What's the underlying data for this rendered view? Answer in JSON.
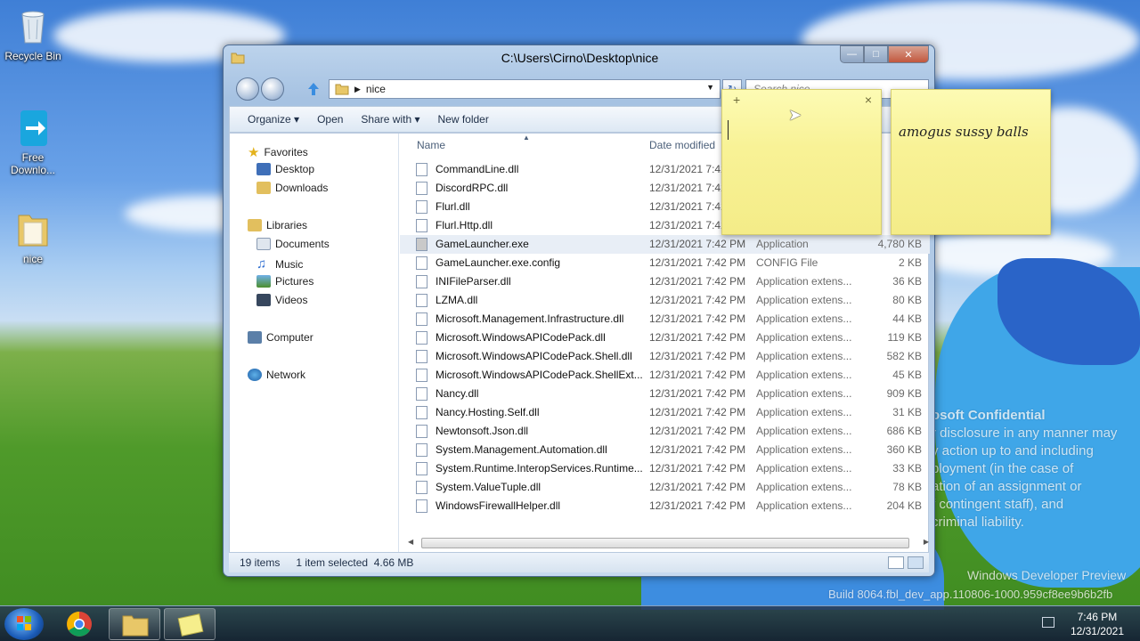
{
  "desktop": {
    "icons": [
      {
        "label": "Recycle Bin",
        "icon": "recycle-bin-icon"
      },
      {
        "label": "Free\nDownlo...",
        "icon": "download-icon"
      },
      {
        "label": "nice",
        "icon": "folder-icon"
      }
    ]
  },
  "window": {
    "title": "C:\\Users\\Cirno\\Desktop\\nice",
    "breadcrumb": "nice",
    "search_placeholder": "Search nice",
    "caption": {
      "minimize": "—",
      "maximize": "□",
      "close": "✕"
    },
    "toolbar": {
      "organize": "Organize ▾",
      "open": "Open",
      "share": "Share with ▾",
      "new_folder": "New folder"
    },
    "nav": {
      "favorites": "Favorites",
      "desktop": "Desktop",
      "downloads": "Downloads",
      "libraries": "Libraries",
      "documents": "Documents",
      "music": "Music",
      "pictures": "Pictures",
      "videos": "Videos",
      "computer": "Computer",
      "network": "Network"
    },
    "columns": {
      "name": "Name",
      "date": "Date modified"
    },
    "files": [
      {
        "name": "CommandLine.dll",
        "date": "12/31/2021 7:42",
        "type": "",
        "size": ""
      },
      {
        "name": "DiscordRPC.dll",
        "date": "12/31/2021 7:42",
        "type": "",
        "size": ""
      },
      {
        "name": "Flurl.dll",
        "date": "12/31/2021 7:42",
        "type": "",
        "size": ""
      },
      {
        "name": "Flurl.Http.dll",
        "date": "12/31/2021 7:42",
        "type": "",
        "size": ""
      },
      {
        "name": "GameLauncher.exe",
        "date": "12/31/2021 7:42 PM",
        "type": "Application",
        "size": "4,780 KB"
      },
      {
        "name": "GameLauncher.exe.config",
        "date": "12/31/2021 7:42 PM",
        "type": "CONFIG File",
        "size": "2 KB"
      },
      {
        "name": "INIFileParser.dll",
        "date": "12/31/2021 7:42 PM",
        "type": "Application extens...",
        "size": "36 KB"
      },
      {
        "name": "LZMA.dll",
        "date": "12/31/2021 7:42 PM",
        "type": "Application extens...",
        "size": "80 KB"
      },
      {
        "name": "Microsoft.Management.Infrastructure.dll",
        "date": "12/31/2021 7:42 PM",
        "type": "Application extens...",
        "size": "44 KB"
      },
      {
        "name": "Microsoft.WindowsAPICodePack.dll",
        "date": "12/31/2021 7:42 PM",
        "type": "Application extens...",
        "size": "119 KB"
      },
      {
        "name": "Microsoft.WindowsAPICodePack.Shell.dll",
        "date": "12/31/2021 7:42 PM",
        "type": "Application extens...",
        "size": "582 KB"
      },
      {
        "name": "Microsoft.WindowsAPICodePack.ShellExt...",
        "date": "12/31/2021 7:42 PM",
        "type": "Application extens...",
        "size": "45 KB"
      },
      {
        "name": "Nancy.dll",
        "date": "12/31/2021 7:42 PM",
        "type": "Application extens...",
        "size": "909 KB"
      },
      {
        "name": "Nancy.Hosting.Self.dll",
        "date": "12/31/2021 7:42 PM",
        "type": "Application extens...",
        "size": "31 KB"
      },
      {
        "name": "Newtonsoft.Json.dll",
        "date": "12/31/2021 7:42 PM",
        "type": "Application extens...",
        "size": "686 KB"
      },
      {
        "name": "System.Management.Automation.dll",
        "date": "12/31/2021 7:42 PM",
        "type": "Application extens...",
        "size": "360 KB"
      },
      {
        "name": "System.Runtime.InteropServices.Runtime...",
        "date": "12/31/2021 7:42 PM",
        "type": "Application extens...",
        "size": "33 KB"
      },
      {
        "name": "System.ValueTuple.dll",
        "date": "12/31/2021 7:42 PM",
        "type": "Application extens...",
        "size": "78 KB"
      },
      {
        "name": "WindowsFirewallHelper.dll",
        "date": "12/31/2021 7:42 PM",
        "type": "Application extens...",
        "size": "204 KB"
      }
    ],
    "status": {
      "count": "19 items",
      "selection": "1 item selected  4.66 MB"
    }
  },
  "sticky_notes": [
    {
      "text": "",
      "add": "+",
      "close": "×"
    },
    {
      "text": "amogus sussy balls"
    }
  ],
  "watermark": {
    "heading": "osoft Confidential",
    "lines": [
      "r disclosure in any manner may",
      "y action up to and including",
      "ployment (in the case of",
      "ation of an assignment or",
      "f contingent staff), and",
      "criminal liability."
    ],
    "product": "Windows Developer Preview",
    "build": "Build 8064.fbl_dev_app.110806-1000.959cf8ee9b6b2fb"
  },
  "taskbar": {
    "time": "7:46 PM",
    "date": "12/31/2021"
  },
  "colors": {
    "selected_row": "#e8eef6",
    "sticky_yellow": "#f8f296",
    "window_frame": "#bcd3ec"
  }
}
